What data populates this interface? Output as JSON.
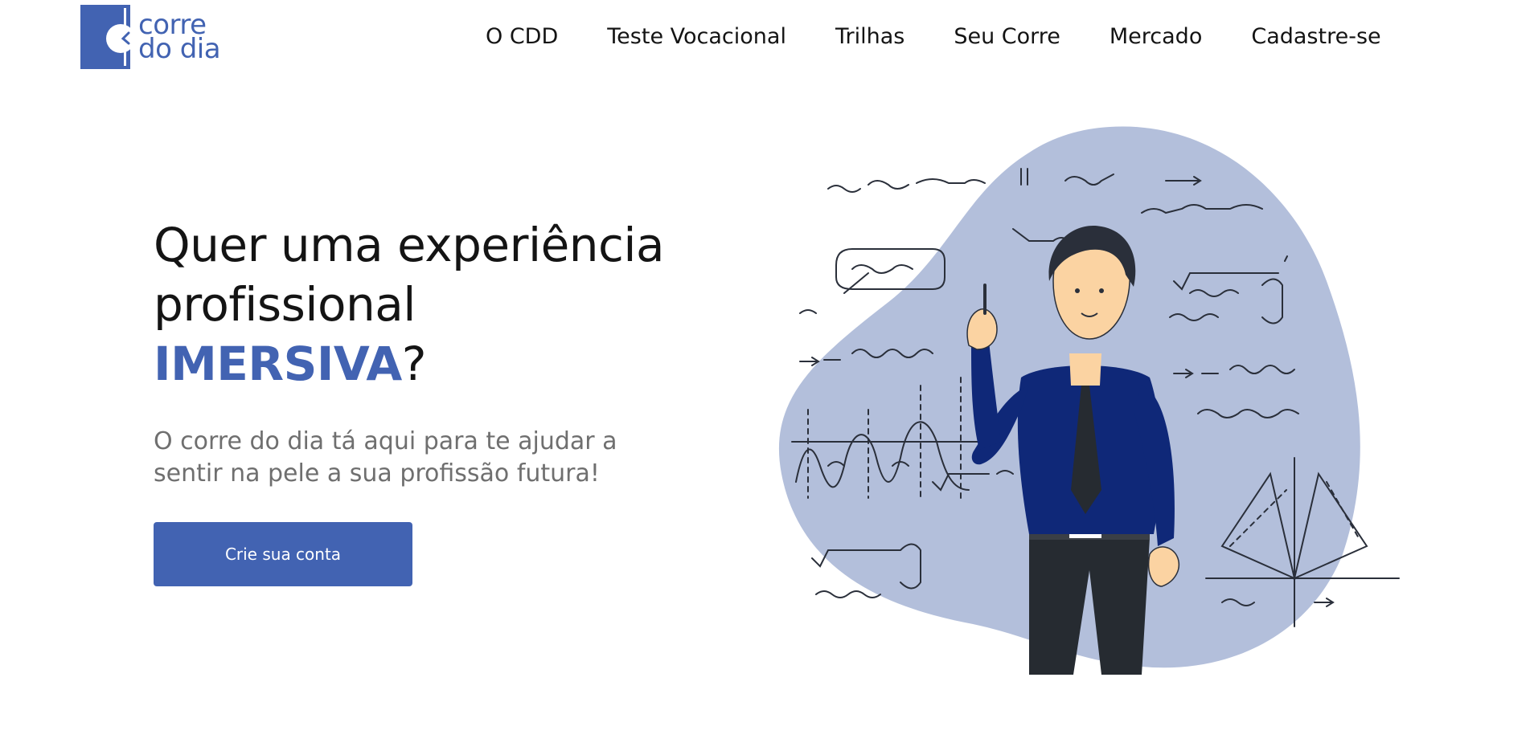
{
  "brand": {
    "name_line1": "corre",
    "name_line2": "do dia",
    "accent_color": "#4263b2"
  },
  "nav": {
    "items": [
      {
        "label": "O CDD"
      },
      {
        "label": "Teste Vocacional"
      },
      {
        "label": "Trilhas"
      },
      {
        "label": "Seu Corre"
      },
      {
        "label": "Mercado"
      },
      {
        "label": "Cadastre-se"
      }
    ]
  },
  "hero": {
    "title_line1": "Quer uma experiência",
    "title_line2": "profissional",
    "title_accent": "IMERSIVA",
    "title_suffix": "?",
    "subtitle": "O corre do dia tá aqui para te ajudar a sentir na pele a sua profissão futura!",
    "cta_label": "Crie sua conta"
  },
  "illustration": {
    "icon": "teacher-with-formulas-illustration",
    "blob_color": "#b3bfdb"
  }
}
